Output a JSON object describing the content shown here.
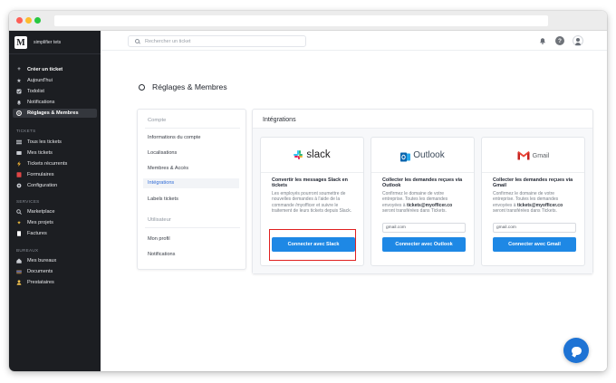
{
  "brand": {
    "logo_letter": "M",
    "name": "simplifier tets"
  },
  "sidebar": {
    "primary": [
      {
        "label": "Créer un ticket",
        "icon": "plus-icon"
      },
      {
        "label": "Aujourd'hui",
        "icon": "star-icon"
      },
      {
        "label": "Todolist",
        "icon": "checkbox-icon"
      },
      {
        "label": "Notifications",
        "icon": "bell-icon"
      },
      {
        "label": "Réglages & Membres",
        "icon": "settings-icon"
      }
    ],
    "tickets_header": "TICKETS",
    "tickets": [
      {
        "label": "Tous les tickets",
        "icon": "list-icon"
      },
      {
        "label": "Mes tickets",
        "icon": "inbox-icon"
      },
      {
        "label": "Tickets récurrents",
        "icon": "bolt-icon"
      },
      {
        "label": "Formulaires",
        "icon": "form-icon"
      },
      {
        "label": "Configuration",
        "icon": "gear-icon"
      }
    ],
    "services_header": "SERVICES",
    "services": [
      {
        "label": "Marketplace",
        "icon": "search-icon"
      },
      {
        "label": "Mes projets",
        "icon": "sparkle-icon"
      },
      {
        "label": "Factures",
        "icon": "document-icon"
      }
    ],
    "bureaux_header": "BUREAUX",
    "bureaux": [
      {
        "label": "Mes bureaux",
        "icon": "home-icon"
      },
      {
        "label": "Documents",
        "icon": "folder-icon"
      },
      {
        "label": "Prestataires",
        "icon": "people-icon"
      }
    ]
  },
  "topbar": {
    "search_placeholder": "Rechercher un ticket"
  },
  "page": {
    "title": "Réglages & Membres"
  },
  "settings_nav": {
    "compte_header": "Compte",
    "compte_items": [
      "Informations du compte",
      "Localisations",
      "Membres & Accès",
      "Intégrations",
      "Labels tickets"
    ],
    "active_item": "Intégrations",
    "utilisateur_header": "Utilisateur",
    "utilisateur_items": [
      "Mon profil",
      "Notifications"
    ]
  },
  "integrations": {
    "title": "Intégrations",
    "slack": {
      "logo_text": "slack",
      "heading": "Convertir les messages Slack en tickets",
      "description": "Les employés pourront soumettre de nouvelles demandes à l'aide de la commande /myofficer et suivre le traitement de leurs tickets depuis Slack.",
      "button": "Connecter avec Slack"
    },
    "outlook": {
      "logo_text": "Outlook",
      "heading": "Collecter les demandes reçues via Outlook",
      "desc_before": "Confirmez le domaine de votre entreprise. Toutes les demandes envoyées à ",
      "desc_email": "tickets@myofficer.co",
      "desc_after": " seront transférées dans Tickets.",
      "input_value": "gmail.com",
      "button": "Connecter avec Outlook"
    },
    "gmail": {
      "logo_text": "Gmail",
      "heading": "Collecter les demandes reçues via Gmail",
      "desc_before": "Confirmez le domaine de votre entreprise. Toutes les demandes envoyées à ",
      "desc_email": "tickets@myofficer.co",
      "desc_after": " seront transférées dans Tickets.",
      "input_value": "gmail.com",
      "button": "Connecter avec Gmail"
    }
  },
  "colors": {
    "accent": "#1e88e5",
    "sidebar_bg": "#1c1e22",
    "highlight": "#e02020",
    "active_link": "#2f6bd6"
  }
}
